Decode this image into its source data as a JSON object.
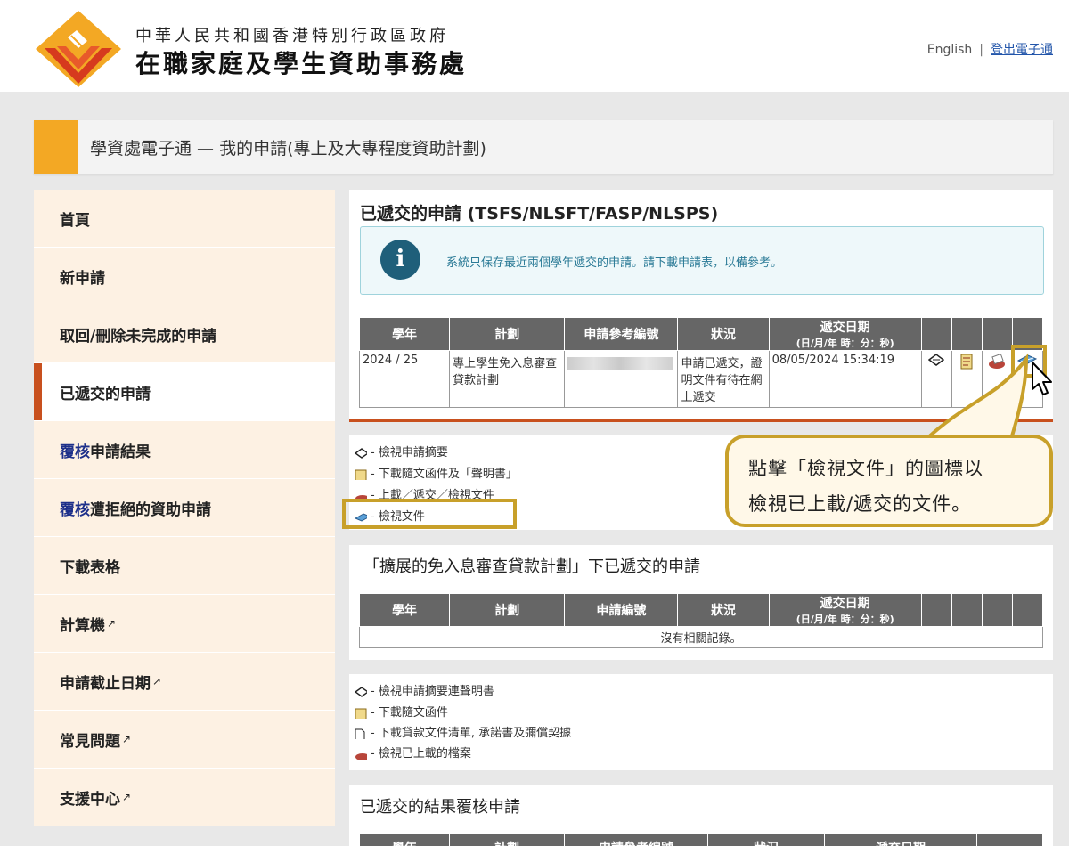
{
  "header": {
    "org_line1": "中華人民共和國香港特別行政區政府",
    "org_line2": "在職家庭及學生資助事務處",
    "lang_link": "English",
    "separator": "|",
    "logout_link": "登出電子通"
  },
  "page_title": "學資處電子通 — 我的申請(專上及大專程度資助計劃)",
  "sidebar": {
    "items": [
      {
        "label": "首頁"
      },
      {
        "label": "新申請"
      },
      {
        "label": "取回/刪除未完成的申請"
      },
      {
        "label": "已遞交的申請"
      },
      {
        "prefix": "覆核",
        "label": "申請結果"
      },
      {
        "prefix": "覆核",
        "label": "遭拒絕的資助申請"
      },
      {
        "label": "下載表格"
      },
      {
        "label": "計算機"
      },
      {
        "label": "申請截止日期"
      },
      {
        "label": "常見問題"
      },
      {
        "label": "支援中心"
      }
    ]
  },
  "section1": {
    "title": "已遞交的申請 (TSFS/NLSFT/FASP/NLSPS)",
    "info_text": "系統只保存最近兩個學年遞交的申請。請下載申請表，以備參考。",
    "headers": [
      "學年",
      "計劃",
      "申請參考編號",
      "狀況",
      "遞交日期",
      "(日/月/年 時：分：秒)"
    ],
    "row": {
      "year": "2024 / 25",
      "scheme": "專上學生免入息審查貸款計劃",
      "status": "申請已遞交，證明文件有待在網上遞交",
      "date": "08/05/2024 15:34:19"
    },
    "legend": [
      "- 檢視申請摘要",
      "- 下載隨文函件及「聲明書」",
      "- 上載／遞交／檢視文件",
      "- 檢視文件"
    ]
  },
  "callout": {
    "line1": "點擊「檢視文件」的圖標以",
    "line2": "檢視已上載/遞交的文件。"
  },
  "section2": {
    "title": "「擴展的免入息審查貸款計劃」下已遞交的申請",
    "headers": [
      "學年",
      "計劃",
      "申請編號",
      "狀況",
      "遞交日期",
      "(日/月/年 時：分：秒)"
    ],
    "empty": "沒有相關記錄。",
    "legend": [
      "- 檢視申請摘要連聲明書",
      "- 下載隨文函件",
      "- 下載貸款文件清單, 承諾書及彌償契據",
      "- 檢視已上載的檔案"
    ]
  },
  "section3": {
    "title": "已遞交的結果覆核申請",
    "headers": [
      "學年",
      "計劃",
      "申請參考編號",
      "狀況",
      "遞交日期"
    ]
  },
  "colors": {
    "accent_orange": "#f3a824",
    "active_red": "#c8501e",
    "highlight_gold": "#c8a02a",
    "table_header": "#666666"
  }
}
